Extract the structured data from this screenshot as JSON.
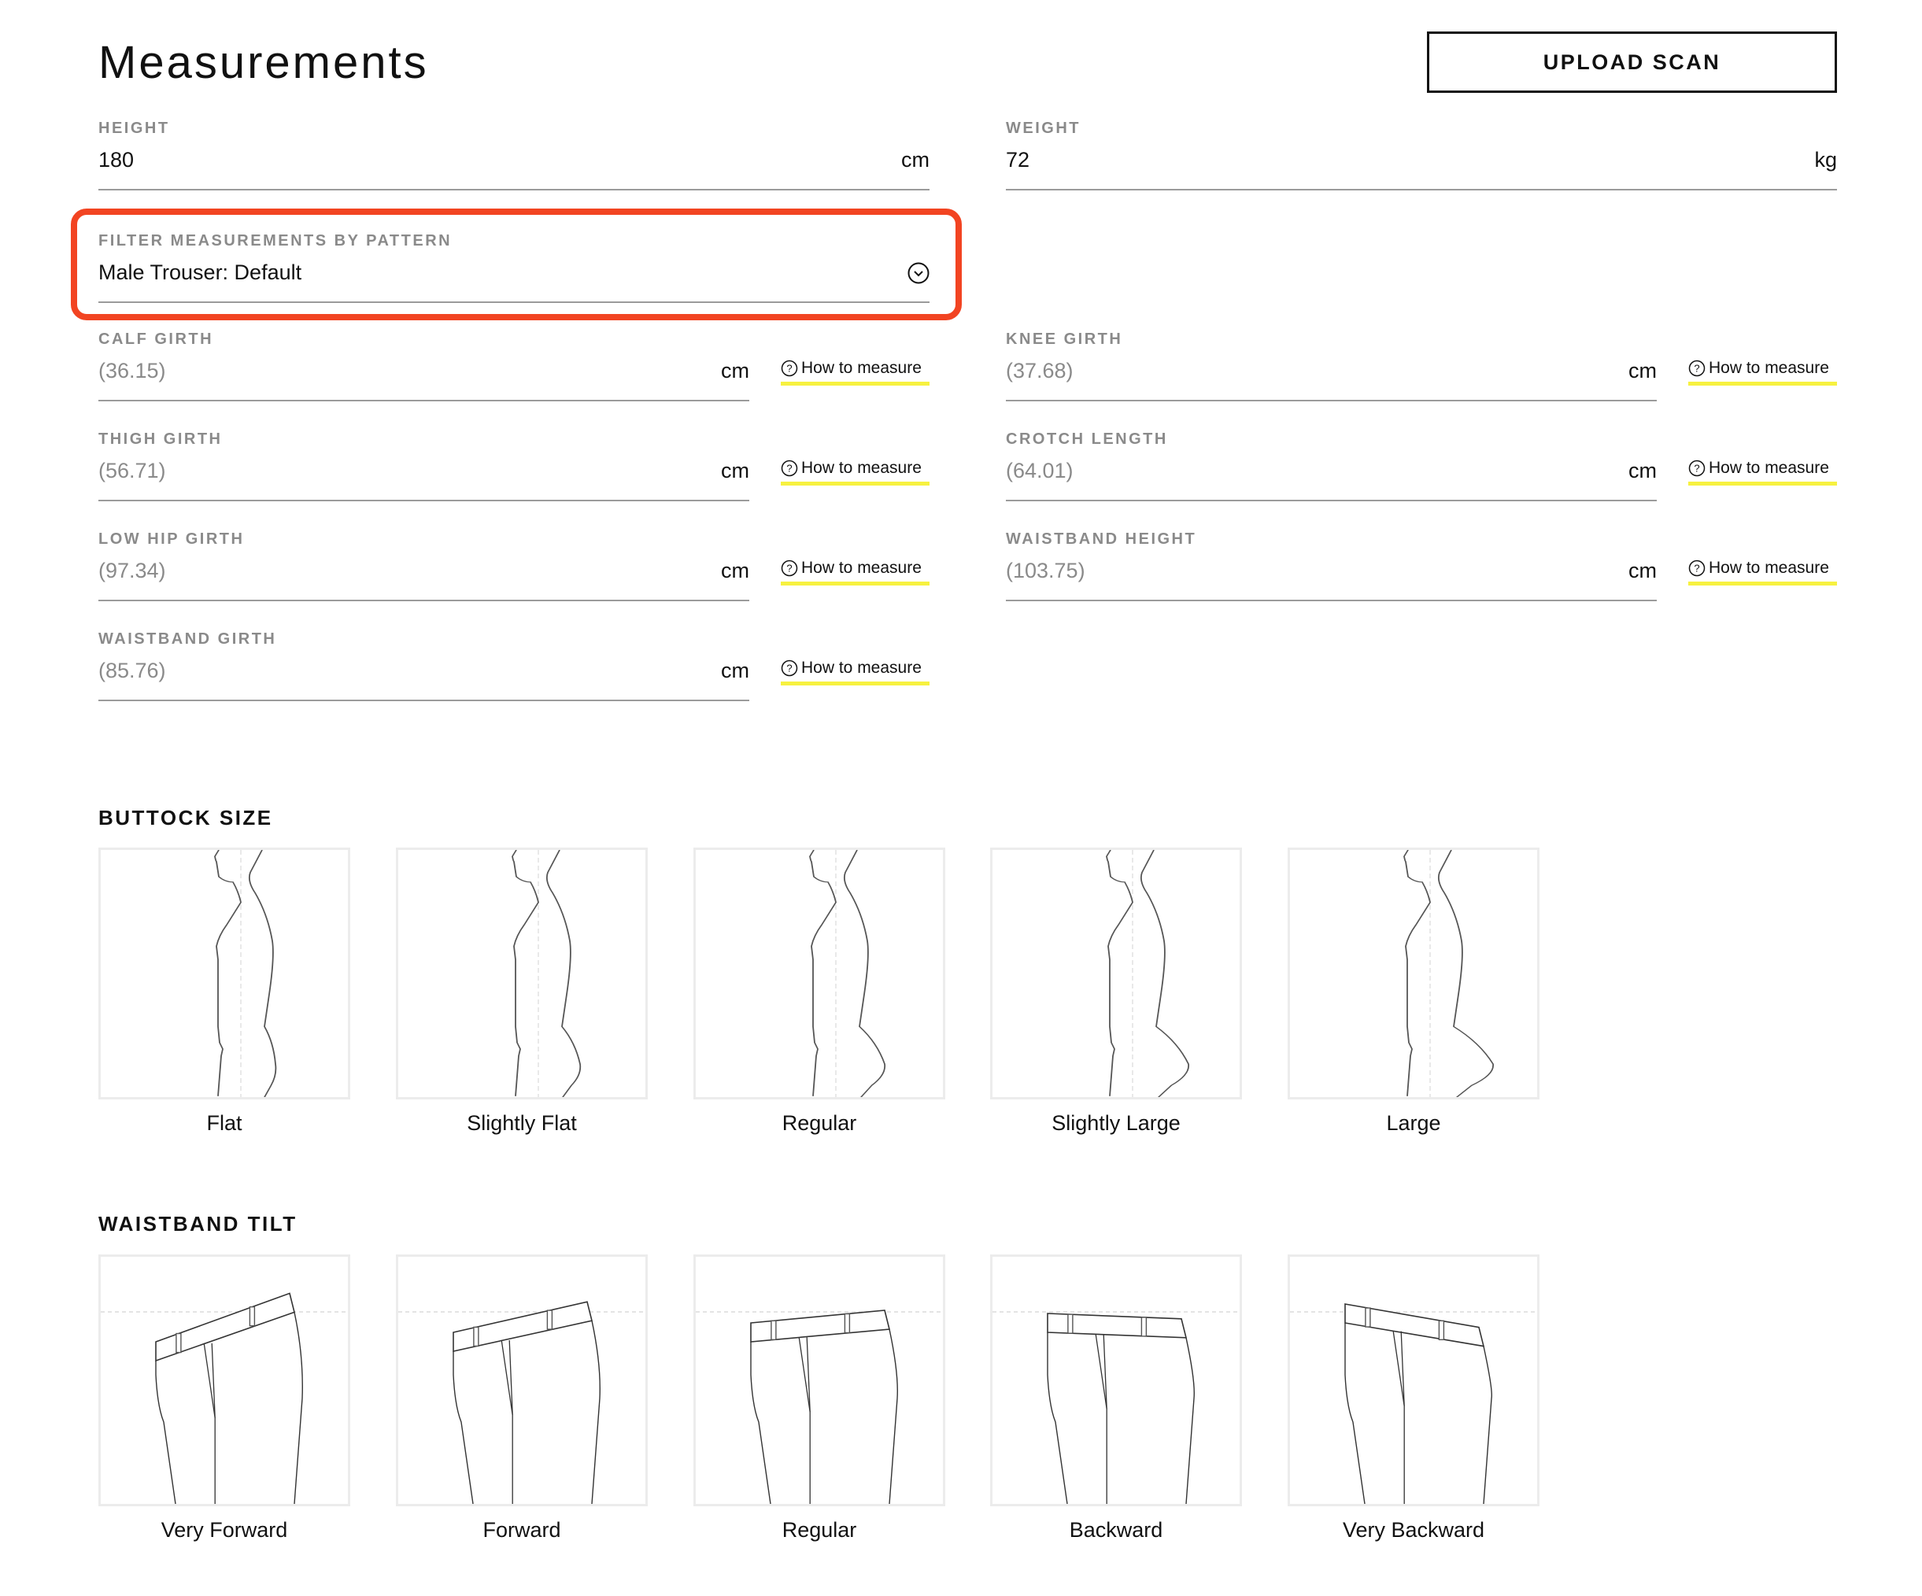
{
  "page": {
    "title": "Measurements",
    "upload_button": "UPLOAD SCAN"
  },
  "body_fields": {
    "height": {
      "label": "HEIGHT",
      "value": "180",
      "unit": "cm"
    },
    "weight": {
      "label": "WEIGHT",
      "value": "72",
      "unit": "kg"
    }
  },
  "filter": {
    "label": "FILTER MEASUREMENTS BY PATTERN",
    "selected": "Male Trouser: Default",
    "icon": "chevron-down-circle-icon",
    "highlight_color": "#f24422"
  },
  "how_to_label": "How to measure",
  "how_to_underline_color": "#f7f140",
  "measurements": [
    {
      "label": "CALF GIRTH",
      "placeholder": "(36.15)",
      "unit": "cm"
    },
    {
      "label": "KNEE GIRTH",
      "placeholder": "(37.68)",
      "unit": "cm"
    },
    {
      "label": "THIGH GIRTH",
      "placeholder": "(56.71)",
      "unit": "cm"
    },
    {
      "label": "CROTCH LENGTH",
      "placeholder": "(64.01)",
      "unit": "cm"
    },
    {
      "label": "LOW HIP GIRTH",
      "placeholder": "(97.34)",
      "unit": "cm"
    },
    {
      "label": "WAISTBAND HEIGHT",
      "placeholder": "(103.75)",
      "unit": "cm"
    },
    {
      "label": "WAISTBAND GIRTH",
      "placeholder": "(85.76)",
      "unit": "cm"
    }
  ],
  "buttock_size": {
    "title": "BUTTOCK SIZE",
    "options": [
      "Flat",
      "Slightly Flat",
      "Regular",
      "Slightly Large",
      "Large"
    ]
  },
  "waistband_tilt": {
    "title": "WAISTBAND TILT",
    "options": [
      "Very Forward",
      "Forward",
      "Regular",
      "Backward",
      "Very Backward"
    ]
  }
}
